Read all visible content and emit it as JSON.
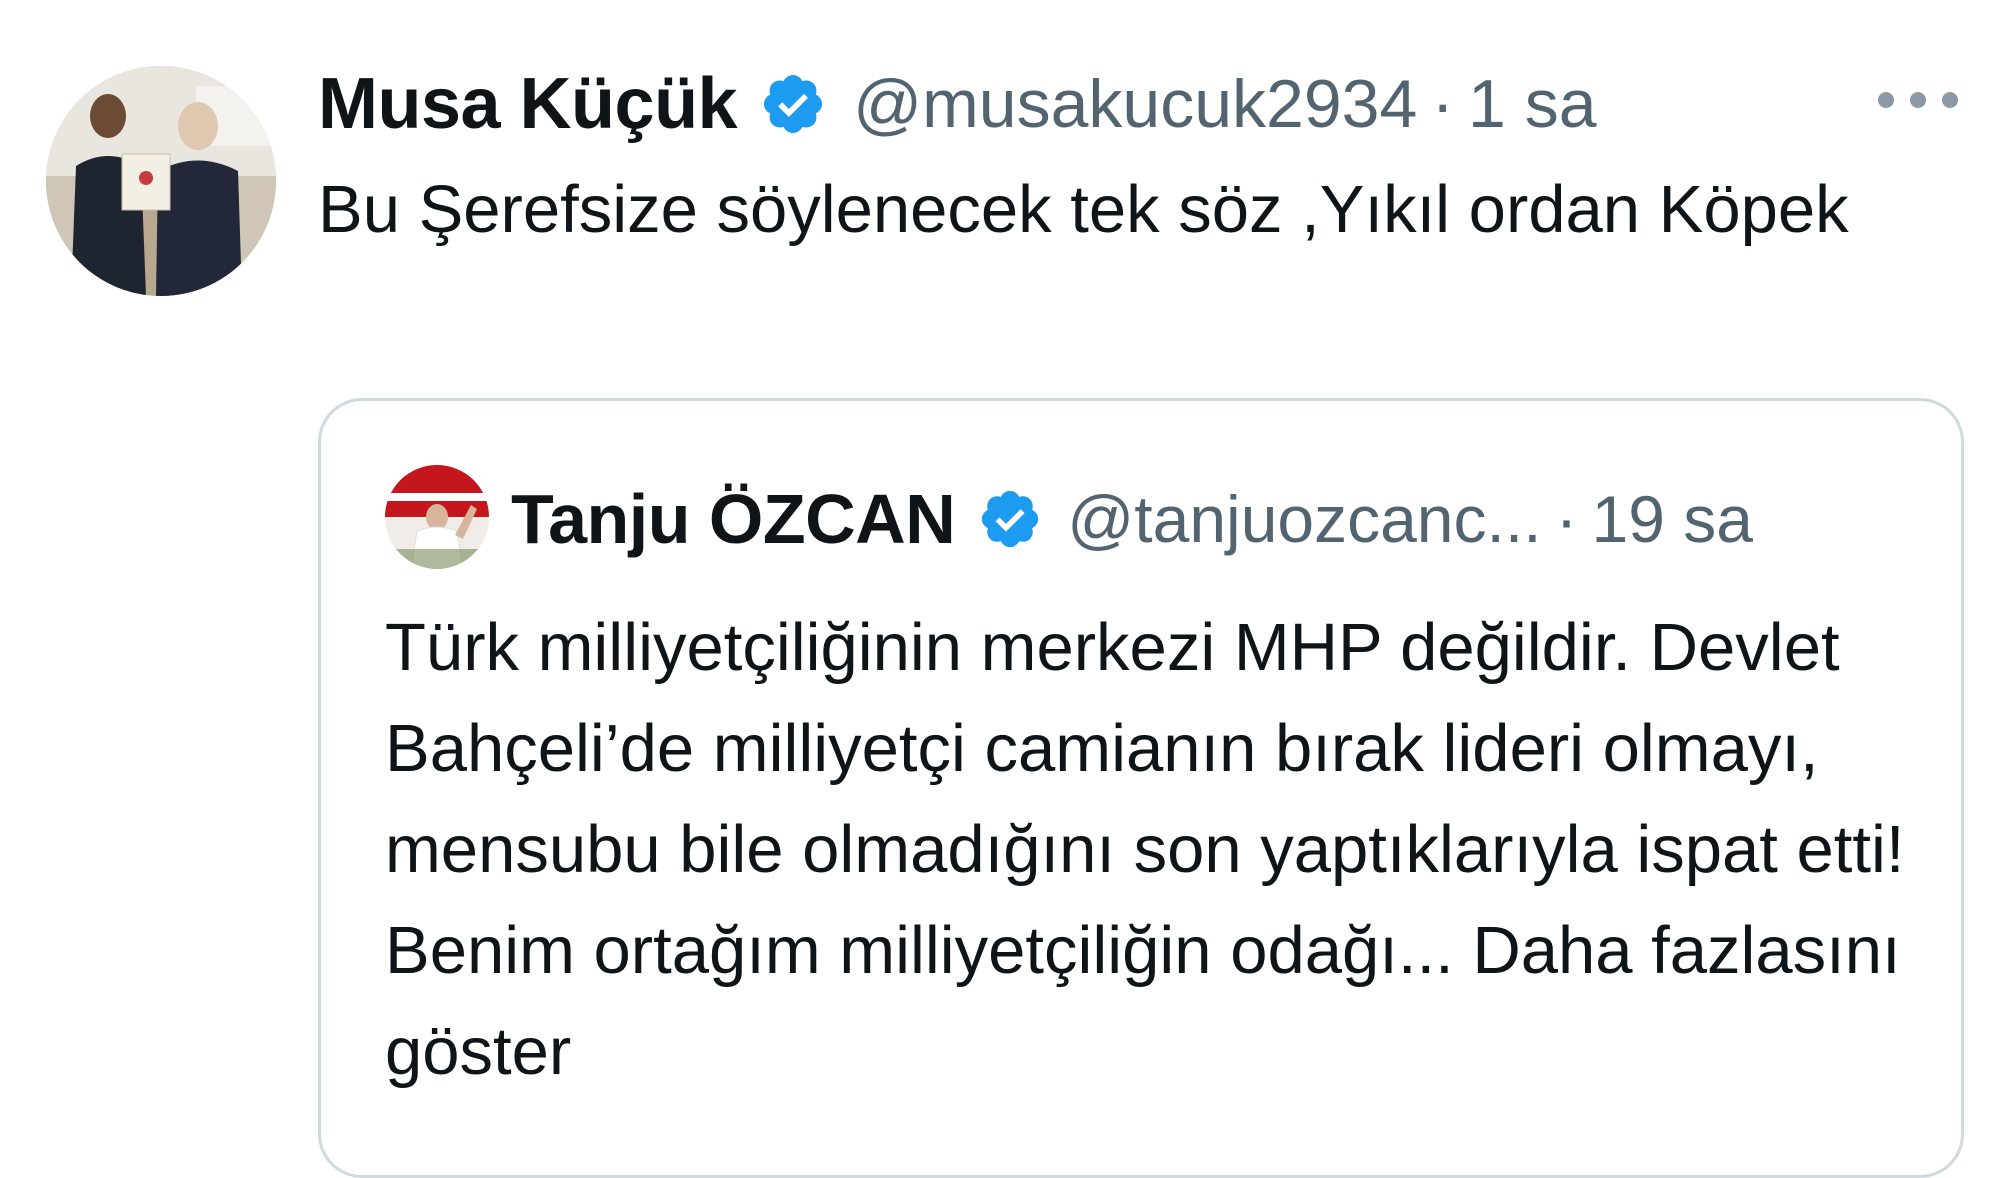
{
  "tweet": {
    "author_name": "Musa Küçük",
    "handle": "@musakucuk2934",
    "separator": "·",
    "time": "1 sa",
    "text": "Bu Şerefsize söylenecek tek söz ,Yıkıl ordan Köpek",
    "more_icon": "ellipsis-icon",
    "verified_icon": "verified-badge-icon"
  },
  "quoted": {
    "author_name": "Tanju ÖZCAN",
    "handle": "@tanjuozcanc...",
    "separator": "·",
    "time": "19 sa",
    "text": "Türk milliyetçiliğinin merkezi MHP değildir. Devlet Bahçeli’de milliyetçi camianın bırak lideri olmayı, mensubu bile olmadığını son yaptıklarıyla ispat etti! Benim ortağım milliyetçiliğin odağı...",
    "show_more": "Daha fazlasını göster",
    "verified_icon": "verified-badge-icon"
  },
  "colors": {
    "verified": "#1d9bf0",
    "secondary_text": "#536471",
    "border": "#cfd9de"
  }
}
